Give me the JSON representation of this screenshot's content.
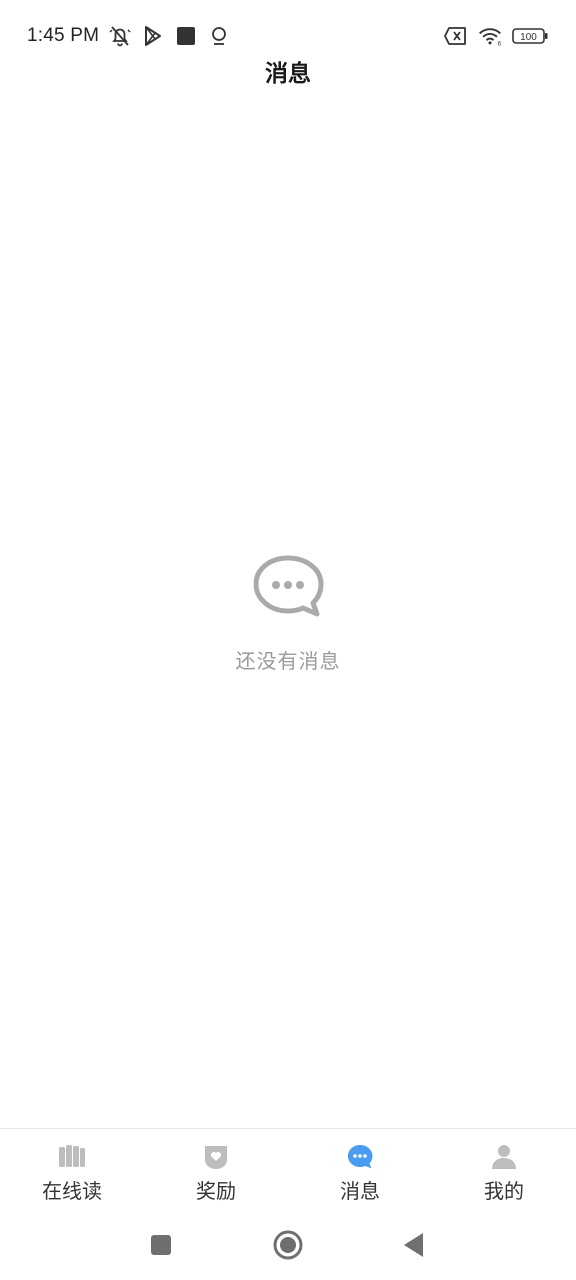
{
  "status_bar": {
    "time": "1:45 PM",
    "battery": "100",
    "left_icons": [
      "mute-bell-icon",
      "play-store-icon",
      "square-app-icon",
      "location-pin-icon"
    ],
    "right_icons": [
      "sim-error-icon",
      "wifi-icon",
      "battery-icon"
    ]
  },
  "header": {
    "title": "消息"
  },
  "empty_state": {
    "icon": "chat-bubble-icon",
    "message": "还没有消息"
  },
  "tabs": [
    {
      "label": "在线读",
      "icon": "books-icon",
      "active": false
    },
    {
      "label": "奖励",
      "icon": "heart-badge-icon",
      "active": false
    },
    {
      "label": "消息",
      "icon": "message-bubble-icon",
      "active": true
    },
    {
      "label": "我的",
      "icon": "person-icon",
      "active": false
    }
  ],
  "colors": {
    "active_tab": "#4a9cf0",
    "inactive_icon": "#bdbdbd",
    "empty_icon": "#aaaaaa",
    "empty_text": "#9a9a9a"
  },
  "nav": {
    "buttons": [
      "recent-apps-icon",
      "home-icon",
      "back-icon"
    ]
  }
}
